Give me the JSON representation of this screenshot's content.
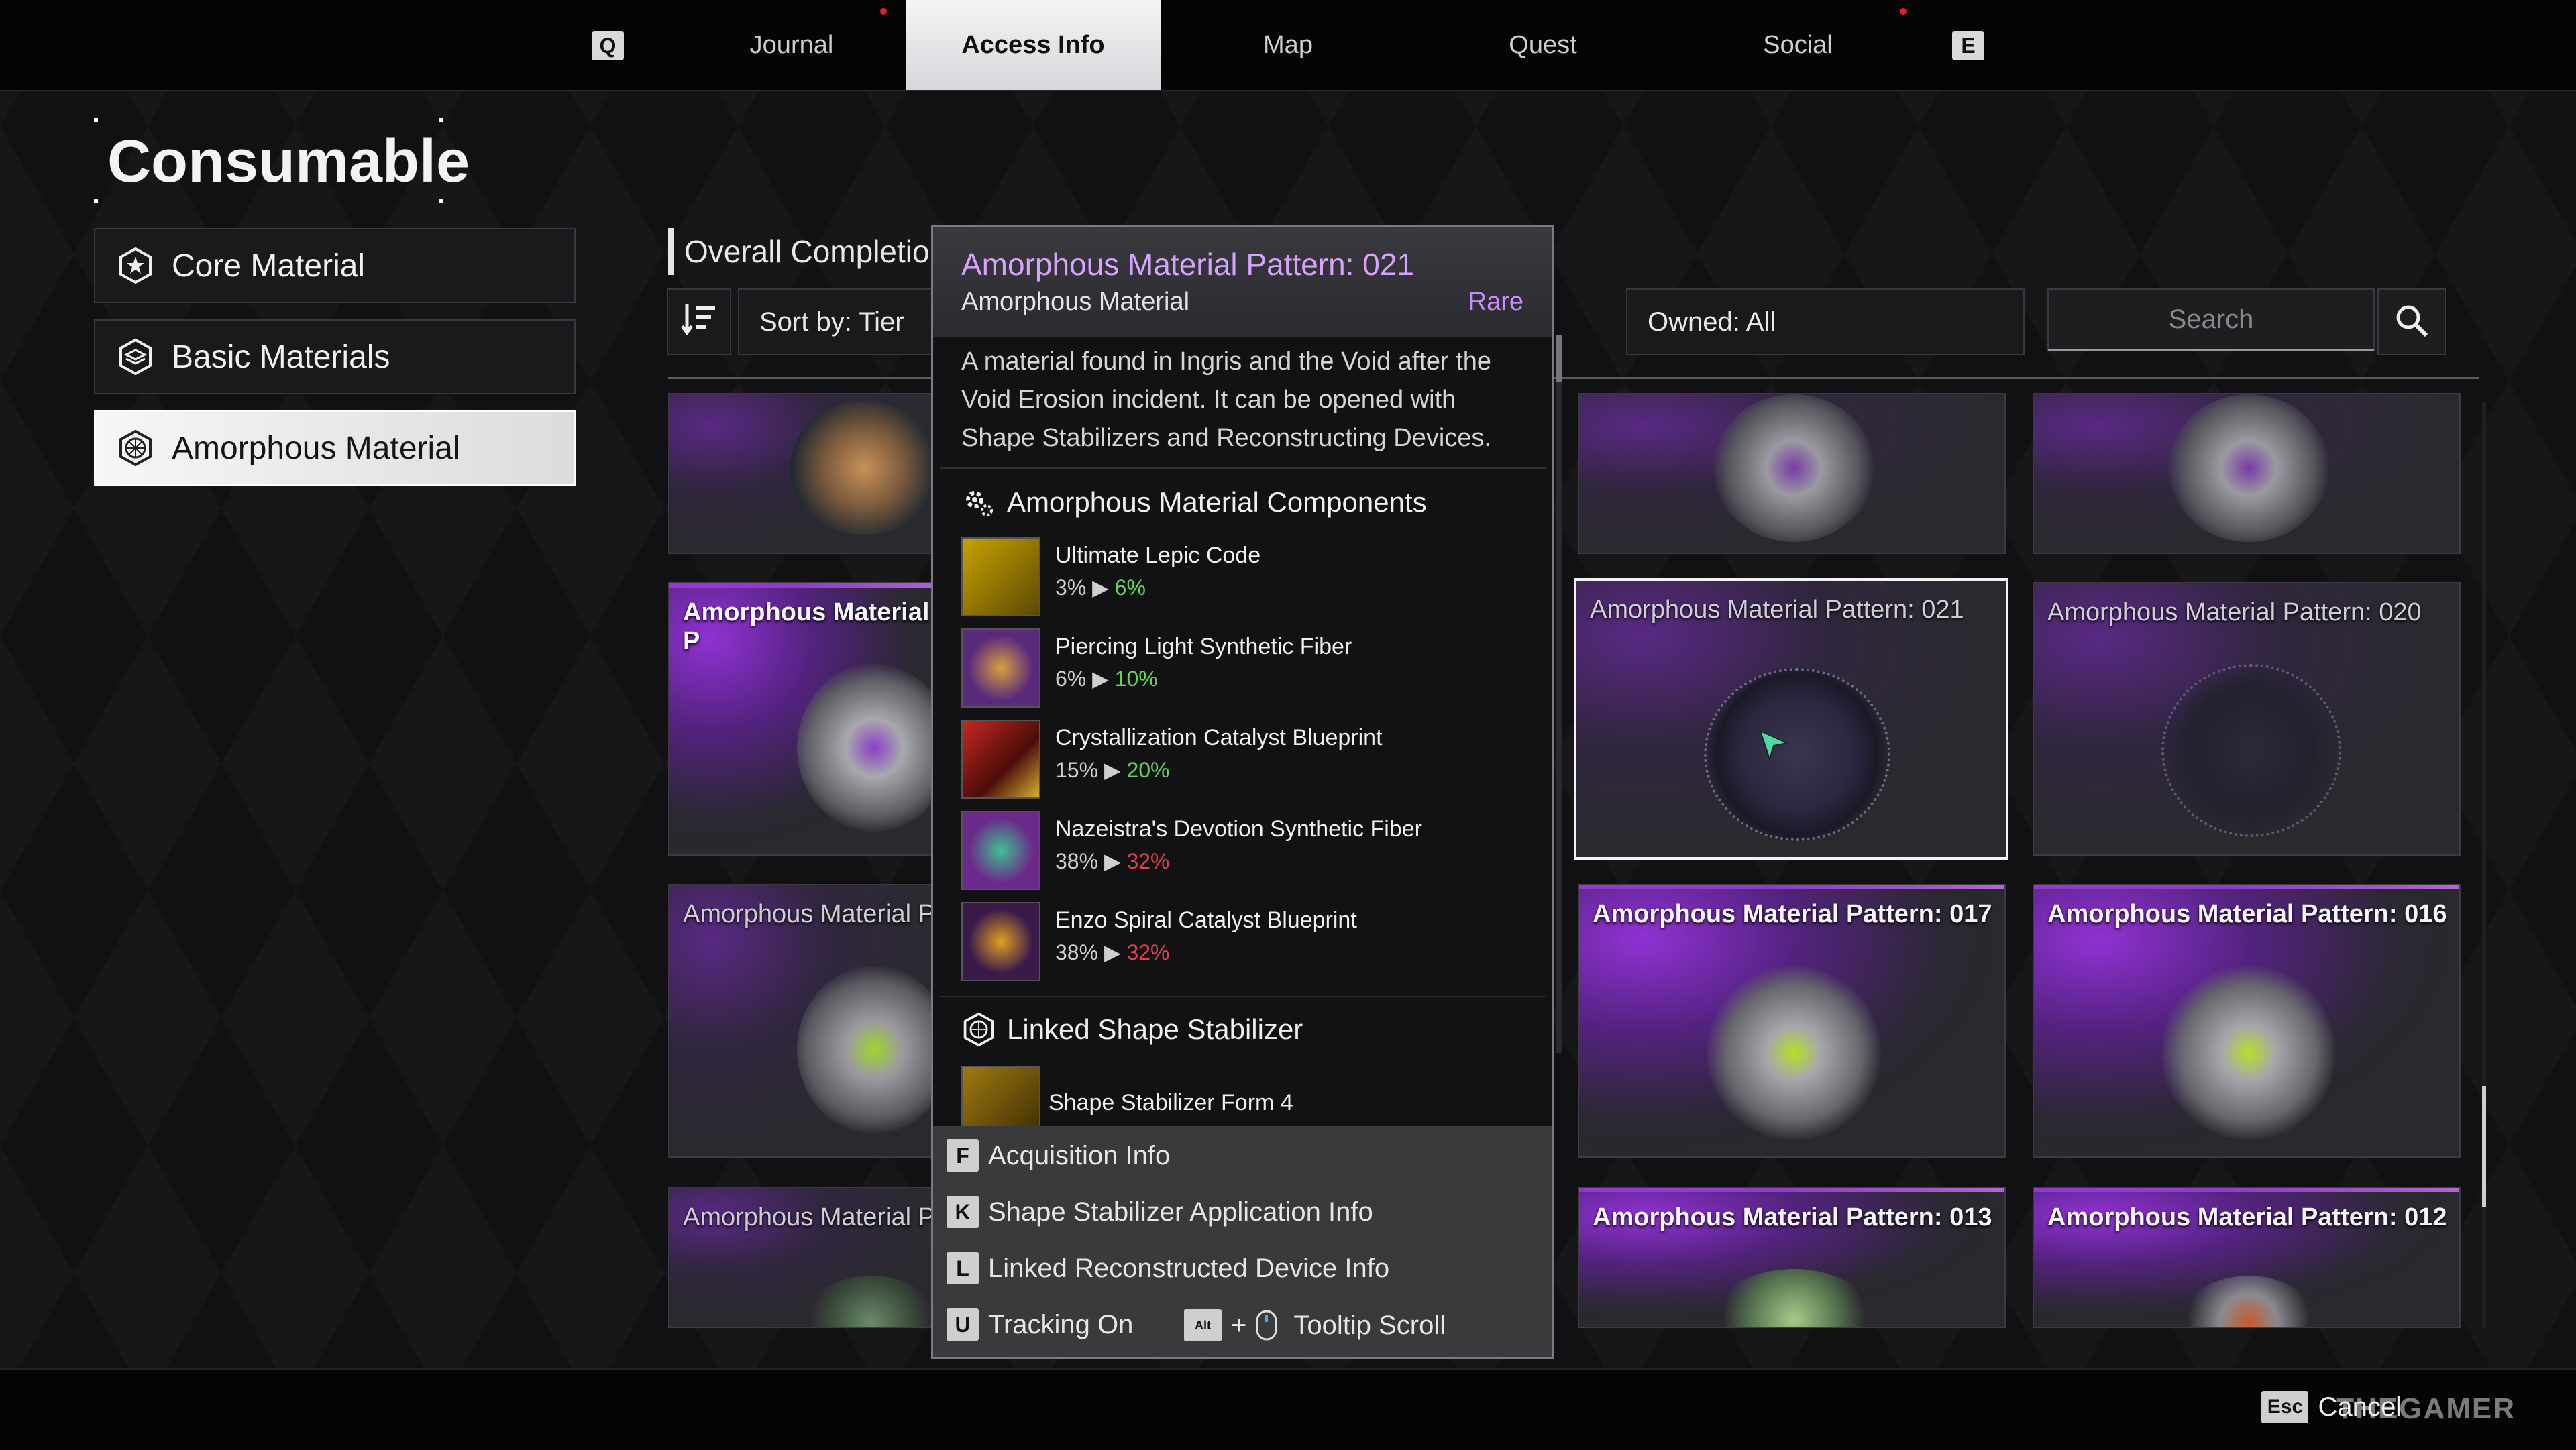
{
  "nav": {
    "key_left": "Q",
    "key_right": "E",
    "tabs": [
      {
        "label": "Journal"
      },
      {
        "label": "Access Info"
      },
      {
        "label": "Map"
      },
      {
        "label": "Quest"
      },
      {
        "label": "Social"
      }
    ]
  },
  "category": {
    "title": "Consumable",
    "items": [
      {
        "label": "Core Material",
        "icon": "star-badge-icon"
      },
      {
        "label": "Basic Materials",
        "icon": "layers-icon"
      },
      {
        "label": "Amorphous Material",
        "icon": "web-hexagon-icon"
      }
    ]
  },
  "toolbar": {
    "completion": "Overall Completion",
    "sort": "Sort by: Tier",
    "owned": "Owned: All",
    "search_placeholder": "Search"
  },
  "grid": {
    "cards": [
      {
        "name": "Amorphous Material Pattern: 021"
      },
      {
        "name": "Amorphous Material Pattern: 020"
      },
      {
        "name": "Amorphous Material Pattern: 017"
      },
      {
        "name": "Amorphous Material Pattern: 016"
      },
      {
        "name": "Amorphous Material Pattern: 013"
      },
      {
        "name": "Amorphous Material Pattern: 012"
      },
      {
        "name": "Amorphous Material P"
      },
      {
        "name": "Amorphous Material P"
      },
      {
        "name": "Amorphous Material P"
      }
    ]
  },
  "tooltip": {
    "title": "Amorphous Material Pattern: 021",
    "subtitle": "Amorphous Material",
    "rarity": "Rare",
    "description": "A material found in Ingris and the Void after the Void Erosion incident. It can be opened with Shape Stabilizers and Reconstructing Devices.",
    "components_heading": "Amorphous Material Components",
    "components": [
      {
        "name": "Ultimate Lepic Code",
        "from": "3%",
        "to": "6%",
        "trend": "up"
      },
      {
        "name": "Piercing Light Synthetic Fiber",
        "from": "6%",
        "to": "10%",
        "trend": "up"
      },
      {
        "name": "Crystallization Catalyst Blueprint",
        "from": "15%",
        "to": "20%",
        "trend": "up"
      },
      {
        "name": "Nazeistra's Devotion Synthetic Fiber",
        "from": "38%",
        "to": "32%",
        "trend": "down"
      },
      {
        "name": "Enzo Spiral Catalyst Blueprint",
        "from": "38%",
        "to": "32%",
        "trend": "down"
      }
    ],
    "stabilizer_heading": "Linked Shape Stabilizer",
    "stabilizer_item": "Shape Stabilizer Form 4",
    "actions": [
      {
        "key": "F",
        "label": "Acquisition Info"
      },
      {
        "key": "K",
        "label": "Shape Stabilizer Application Info"
      },
      {
        "key": "L",
        "label": "Linked Reconstructed Device Info"
      },
      {
        "key": "U",
        "label": "Tracking On"
      }
    ],
    "scroll_key": "Alt",
    "scroll_label": "Tooltip Scroll"
  },
  "footer": {
    "esc_key": "Esc",
    "esc_label": "Cancel",
    "watermark": "THEGAMER"
  },
  "colors": {
    "rare": "#c98bff",
    "up": "#64d35a",
    "down": "#e5404a",
    "accent": "#9b3be0"
  }
}
